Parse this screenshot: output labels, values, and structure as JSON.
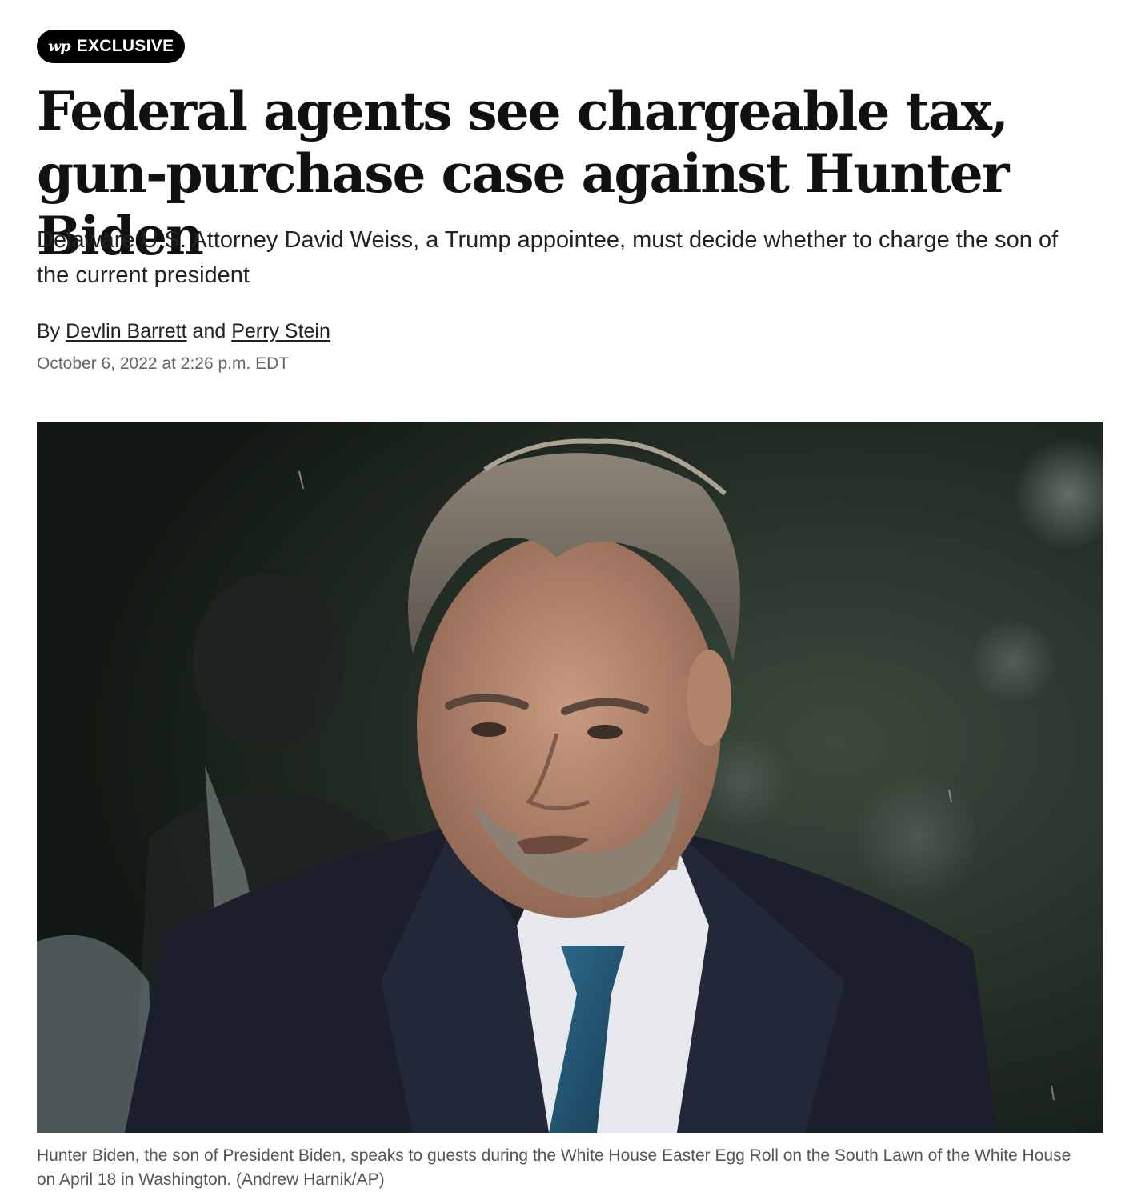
{
  "badge": {
    "logo": "wp",
    "label": "EXCLUSIVE"
  },
  "article": {
    "headline": "Federal agents see chargeable tax, gun-purchase case against Hunter Biden",
    "deck": "Delaware U.S. Attorney David Weiss, a Trump appointee, must decide whether to charge the son of the current president",
    "byline": {
      "prefix": "By",
      "authors": [
        "Devlin Barrett",
        "Perry Stein"
      ],
      "conjunction": "and"
    },
    "date": "October 6, 2022 at 2:26 p.m. EDT"
  },
  "photo": {
    "caption": "Hunter Biden, the son of President Biden, speaks to guests during the White House Easter Egg Roll on the South Lawn of the White House on April 18 in Washington. (Andrew Harnik/AP)"
  },
  "colors": {
    "text": "#111111",
    "muted": "#666666",
    "badge_bg": "#000000"
  }
}
